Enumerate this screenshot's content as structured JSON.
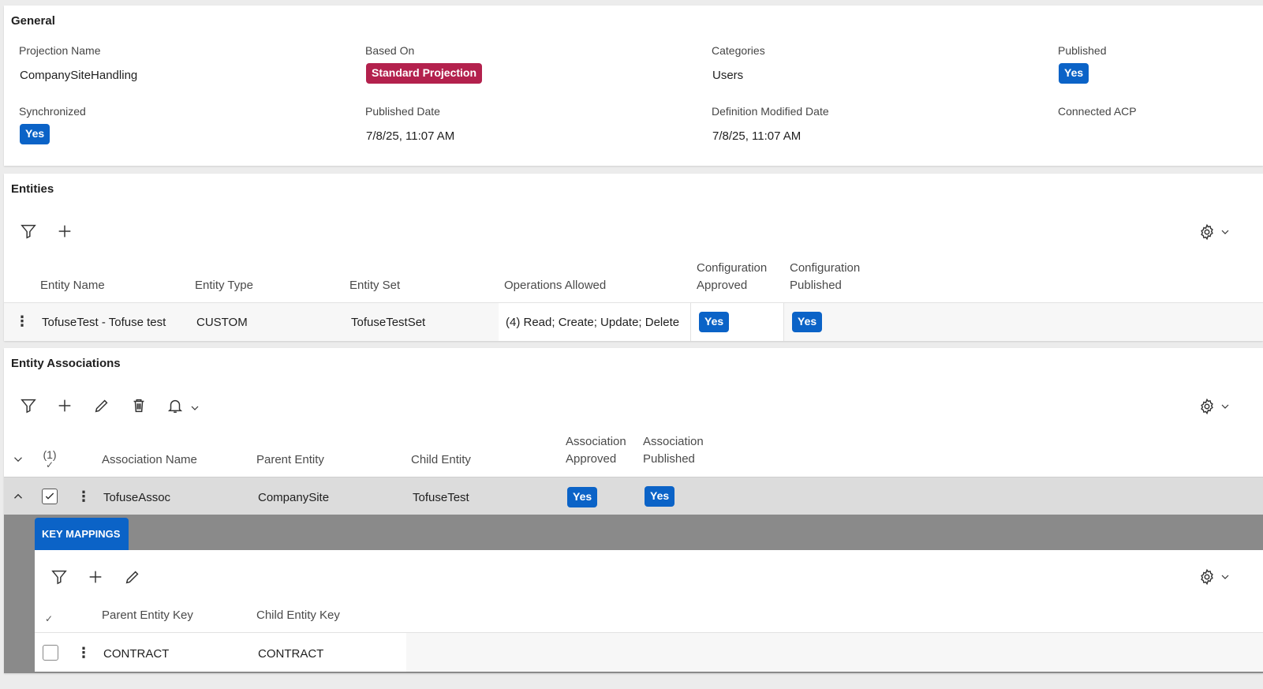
{
  "general": {
    "title": "General",
    "fields": {
      "projection_name": {
        "label": "Projection Name",
        "value": "CompanySiteHandling"
      },
      "based_on": {
        "label": "Based On",
        "value": "Standard Projection"
      },
      "categories": {
        "label": "Categories",
        "value": "Users"
      },
      "published": {
        "label": "Published",
        "value": "Yes"
      },
      "synchronized": {
        "label": "Synchronized",
        "value": "Yes"
      },
      "published_date": {
        "label": "Published Date",
        "value": "7/8/25, 11:07 AM"
      },
      "definition_modified_date": {
        "label": "Definition Modified Date",
        "value": "7/8/25, 11:07 AM"
      },
      "connected_acp": {
        "label": "Connected ACP",
        "value": ""
      }
    }
  },
  "entities": {
    "title": "Entities",
    "columns": {
      "entity_name": "Entity Name",
      "entity_type": "Entity Type",
      "entity_set": "Entity Set",
      "operations_allowed": "Operations Allowed",
      "config_approved_1": "Configuration",
      "config_approved_2": "Approved",
      "config_published_1": "Configuration",
      "config_published_2": "Published"
    },
    "rows": [
      {
        "entity_name": "TofuseTest - Tofuse test",
        "entity_type": "CUSTOM",
        "entity_set": "TofuseTestSet",
        "operations_allowed": "(4) Read; Create; Update; Delete",
        "config_approved": "Yes",
        "config_published": "Yes"
      }
    ]
  },
  "associations": {
    "title": "Entity Associations",
    "selected_count": "(1)",
    "columns": {
      "association_name": "Association Name",
      "parent_entity": "Parent Entity",
      "child_entity": "Child Entity",
      "assoc_approved_1": "Association",
      "assoc_approved_2": "Approved",
      "assoc_published_1": "Association",
      "assoc_published_2": "Published"
    },
    "rows": [
      {
        "association_name": "TofuseAssoc",
        "parent_entity": "CompanySite",
        "child_entity": "TofuseTest",
        "assoc_approved": "Yes",
        "assoc_published": "Yes"
      }
    ]
  },
  "key_mappings": {
    "tab_label": "KEY MAPPINGS",
    "columns": {
      "parent_entity_key": "Parent Entity Key",
      "child_entity_key": "Child Entity Key"
    },
    "rows": [
      {
        "parent_entity_key": "CONTRACT",
        "child_entity_key": "CONTRACT"
      }
    ]
  },
  "icons": {
    "filter": "filter-icon",
    "add": "plus-icon",
    "edit": "pencil-icon",
    "delete": "trash-icon",
    "notify": "bell-icon",
    "settings": "gear-icon"
  },
  "colors": {
    "accent": "#0b63c7",
    "standard_projection": "#b3214d",
    "selected_row": "#dcdcdc",
    "detail_band": "#8a8a8a"
  }
}
